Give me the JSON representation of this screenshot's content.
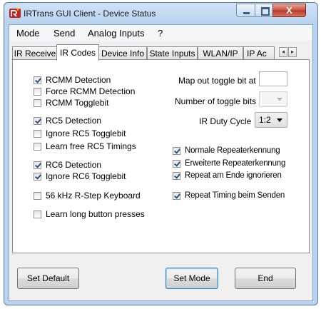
{
  "window": {
    "title": "IRTrans GUI Client - Device Status",
    "close_glyph": "X"
  },
  "menu": [
    "Mode",
    "Send",
    "Analog Inputs",
    "?"
  ],
  "tabs": [
    "IR Receive",
    "IR Codes",
    "Device Info",
    "State Inputs",
    "WLAN/IP",
    "IP Ac"
  ],
  "active_tab": "IR Codes",
  "tab_scroll": {
    "left": "◂",
    "right": "▸"
  },
  "left_options": [
    {
      "label": "RCMM Detection",
      "checked": true
    },
    {
      "label": "Force RCMM Detection",
      "checked": false
    },
    {
      "label": "RCMM Togglebit",
      "checked": false
    },
    {
      "label": "RC5 Detection",
      "checked": true
    },
    {
      "label": "Ignore RC5 Togglebit",
      "checked": false
    },
    {
      "label": "Learn free RC5 Timings",
      "checked": false
    },
    {
      "label": "RC6 Detection",
      "checked": true
    },
    {
      "label": "Ignore RC6 Togglebit",
      "checked": true
    },
    {
      "label": "56 kHz R-Step Keyboard",
      "checked": false
    },
    {
      "label": "Learn long button presses",
      "checked": false
    }
  ],
  "right_fields": {
    "map_toggle_label": "Map out toggle bit at",
    "map_toggle_value": "",
    "num_toggle_label": "Number of toggle bits",
    "num_toggle_value": "",
    "duty_cycle_label": "IR Duty Cycle",
    "duty_cycle_value": "1:2"
  },
  "right_options": [
    {
      "label": "Normale Repeaterkennung",
      "checked": true
    },
    {
      "label": "Erweiterte Repeaterkennung",
      "checked": true
    },
    {
      "label": "Repeat am Ende ignorieren",
      "checked": true
    },
    {
      "label": "Repeat Timing beim Senden",
      "checked": true
    }
  ],
  "buttons": {
    "set_default": "Set Default",
    "set_mode": "Set Mode",
    "end": "End"
  }
}
